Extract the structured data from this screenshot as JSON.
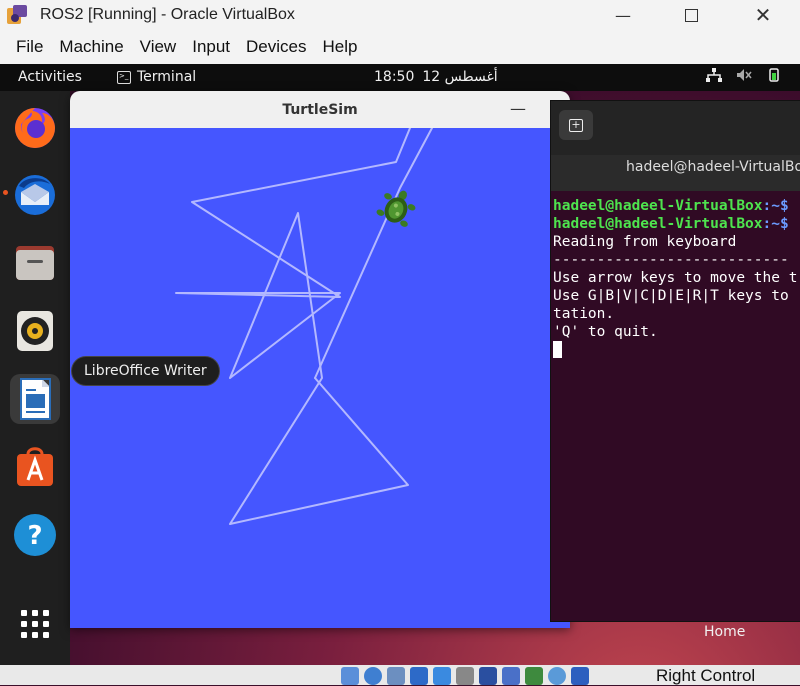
{
  "host": {
    "window_title": "ROS2 [Running] - Oracle VirtualBox",
    "menu": [
      "File",
      "Machine",
      "View",
      "Input",
      "Devices",
      "Help"
    ],
    "host_key": "Right Control"
  },
  "guest": {
    "topbar": {
      "activities": "Activities",
      "app_name": "Terminal",
      "time": "18:50",
      "date": "12 أغسطس"
    },
    "dock": {
      "items": [
        "firefox-icon",
        "thunderbird-icon",
        "files-icon",
        "rhythmbox-icon",
        "libreoffice-writer-icon",
        "app-center-icon",
        "help-icon",
        "show-apps-icon"
      ],
      "tooltip": "LibreOffice Writer"
    },
    "turtlesim": {
      "title": "TurtleSim",
      "background_color": "#4556ff",
      "pen_color": "#b3b8ff"
    },
    "terminal": {
      "title": "hadeel@hadeel-VirtualBox: ~",
      "prompt_user": "hadeel@hadeel-VirtualBox",
      "prompt_path": ":~$",
      "lines": [
        "Reading from keyboard",
        "---------------------------",
        "Use arrow keys to move the t",
        "Use G|B|V|C|D|E|R|T keys to",
        "tation.",
        "'Q' to quit."
      ]
    },
    "desktop": {
      "home_label": "Home"
    }
  }
}
